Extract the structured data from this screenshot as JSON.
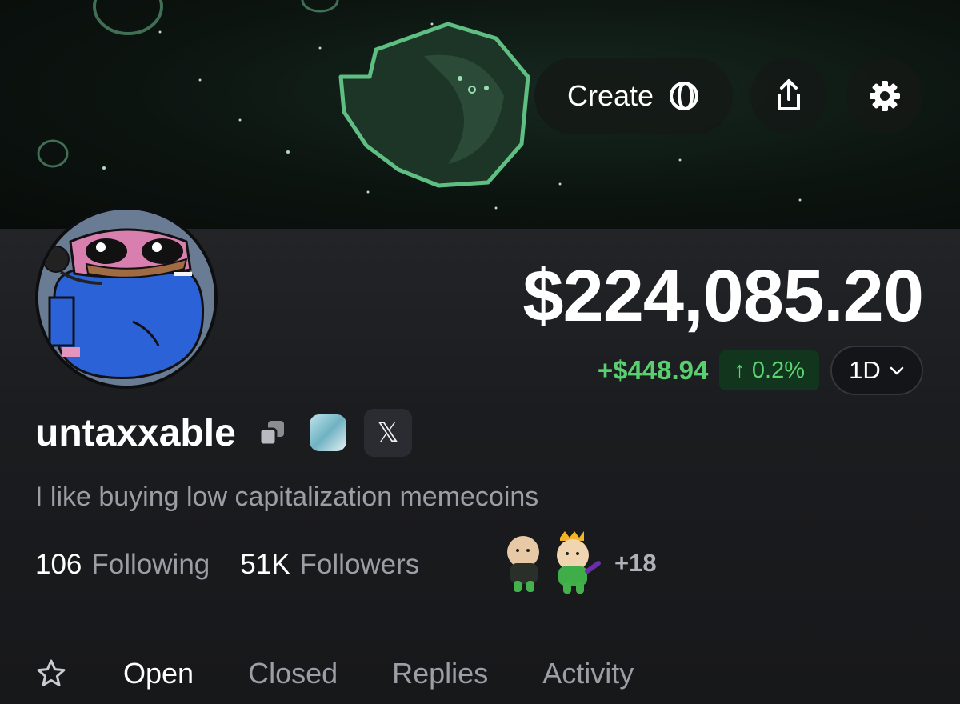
{
  "header": {
    "create_label": "Create",
    "icons": {
      "create": "loading-ring-icon",
      "share": "share-icon",
      "settings": "gear-icon"
    }
  },
  "profile": {
    "balance": "$224,085.20",
    "change_amount": "+$448.94",
    "change_arrow": "↑",
    "change_percent": "0.2%",
    "range": "1D",
    "username": "untaxxable",
    "x_label": "𝕏",
    "bio": "I like buying low capitalization memecoins",
    "following_count": "106",
    "following_label": "Following",
    "followers_count": "51K",
    "followers_label": "Followers",
    "mutuals_more": "+18"
  },
  "tabs": [
    "Open",
    "Closed",
    "Replies",
    "Activity"
  ],
  "colors": {
    "positive": "#59d06f",
    "positive_bg": "#12351d",
    "background": "#1b1c1f",
    "muted_text": "#9c9ea6"
  }
}
